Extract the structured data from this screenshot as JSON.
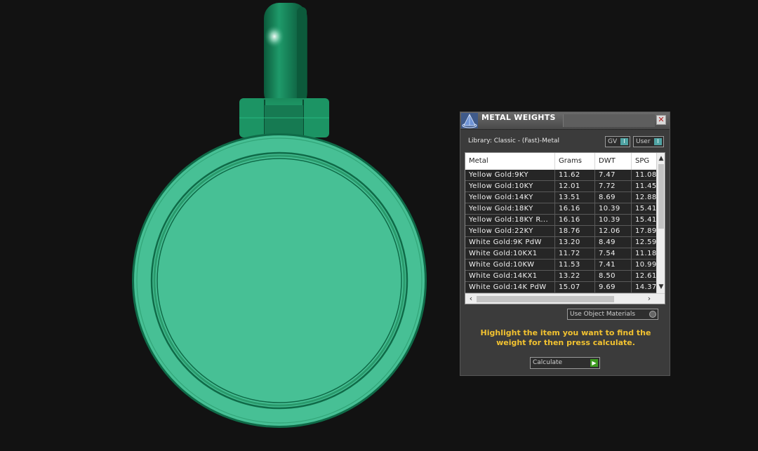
{
  "panel": {
    "title": "METAL WEIGHTS",
    "close_glyph": "✕",
    "library_label": "Library: Classic - (Fast)-Metal",
    "toggles": [
      {
        "label": "GV",
        "knob": "I"
      },
      {
        "label": "User",
        "knob": "I"
      }
    ],
    "table": {
      "headers": [
        "Metal",
        "Grams",
        "DWT",
        "SPG"
      ],
      "rows": [
        [
          "Yellow Gold:9KY",
          "11.62",
          "7.47",
          "11.08"
        ],
        [
          "Yellow Gold:10KY",
          "12.01",
          "7.72",
          "11.45"
        ],
        [
          "Yellow Gold:14KY",
          "13.51",
          "8.69",
          "12.88"
        ],
        [
          "Yellow Gold:18KY",
          "16.16",
          "10.39",
          "15.41"
        ],
        [
          "Yellow Gold:18KY R...",
          "16.16",
          "10.39",
          "15.41"
        ],
        [
          "Yellow Gold:22KY",
          "18.76",
          "12.06",
          "17.89"
        ],
        [
          "White Gold:9K PdW",
          "13.20",
          "8.49",
          "12.59"
        ],
        [
          "White Gold:10KX1",
          "11.72",
          "7.54",
          "11.18"
        ],
        [
          "White Gold:10KW",
          "11.53",
          "7.41",
          "10.99"
        ],
        [
          "White Gold:14KX1",
          "13.22",
          "8.50",
          "12.61"
        ],
        [
          "White Gold:14K PdW",
          "15.07",
          "9.69",
          "14.37"
        ]
      ]
    },
    "scroll_glyphs": {
      "up": "▲",
      "down": "▼",
      "left": "‹",
      "right": "›"
    },
    "use_object_materials": "Use Object Materials",
    "instructions": "Highlight the item you want to find the weight for then press calculate.",
    "calculate_label": "Calculate",
    "calculate_glyph": "▶"
  },
  "viewport": {
    "model": "pendant-3d-model",
    "model_color": "#47c095",
    "model_dark": "#0f6b48"
  }
}
